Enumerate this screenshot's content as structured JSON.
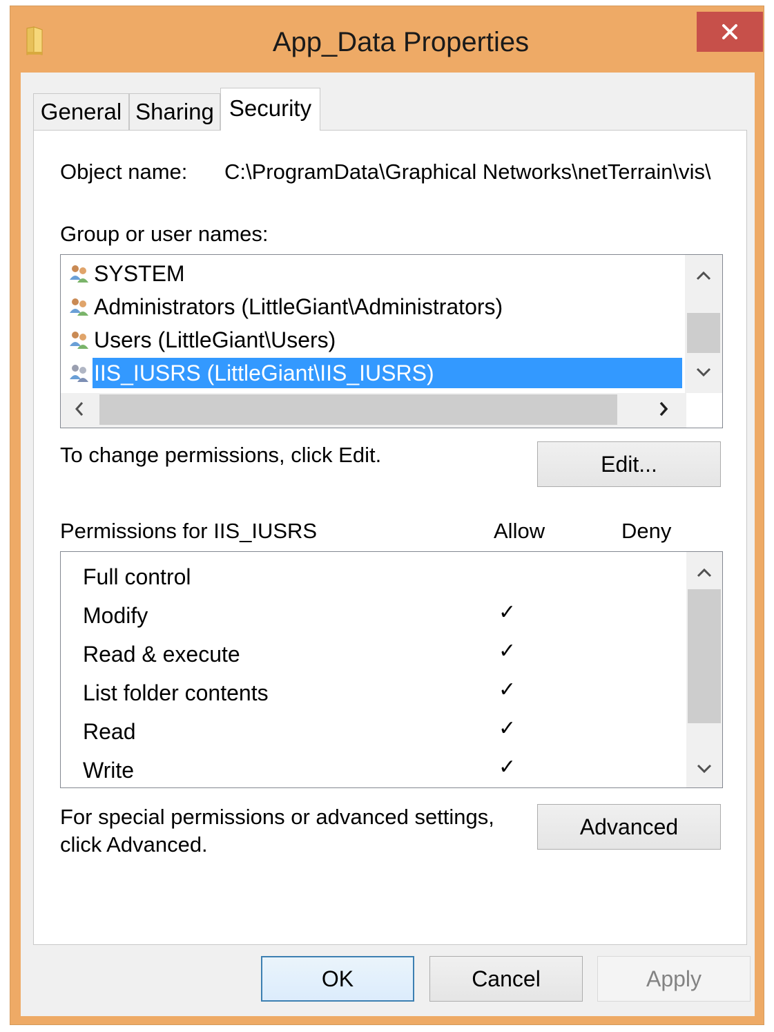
{
  "window": {
    "title": "App_Data Properties",
    "accent": "#eeaa66",
    "close_color": "#c7504a"
  },
  "tabs": [
    {
      "label": "General",
      "active": false
    },
    {
      "label": "Sharing",
      "active": false
    },
    {
      "label": "Security",
      "active": true
    }
  ],
  "object": {
    "label": "Object name:",
    "value": "C:\\ProgramData\\Graphical Networks\\netTerrain\\vis\\"
  },
  "groups": {
    "label": "Group or user names:",
    "items": [
      {
        "name": "SYSTEM",
        "icon": "users-group-icon",
        "selected": false
      },
      {
        "name": "Administrators (LittleGiant\\Administrators)",
        "icon": "users-group-icon",
        "selected": false
      },
      {
        "name": "Users (LittleGiant\\Users)",
        "icon": "users-group-icon",
        "selected": false
      },
      {
        "name": "IIS_IUSRS (LittleGiant\\IIS_IUSRS)",
        "icon": "users-group-icon",
        "selected": true
      }
    ]
  },
  "edit": {
    "hint": "To change permissions, click Edit.",
    "button": "Edit..."
  },
  "permissions": {
    "header": "Permissions for IIS_IUSRS",
    "allow_label": "Allow",
    "deny_label": "Deny",
    "rows": [
      {
        "name": "Full control",
        "allow": false,
        "deny": false
      },
      {
        "name": "Modify",
        "allow": true,
        "deny": false
      },
      {
        "name": "Read & execute",
        "allow": true,
        "deny": false
      },
      {
        "name": "List folder contents",
        "allow": true,
        "deny": false
      },
      {
        "name": "Read",
        "allow": true,
        "deny": false
      },
      {
        "name": "Write",
        "allow": true,
        "deny": false
      }
    ],
    "check_glyph": "✓"
  },
  "advanced": {
    "hint_line1": "For special permissions or advanced settings,",
    "hint_line2": "click Advanced.",
    "button": "Advanced"
  },
  "footer": {
    "ok": "OK",
    "cancel": "Cancel",
    "apply": "Apply"
  }
}
